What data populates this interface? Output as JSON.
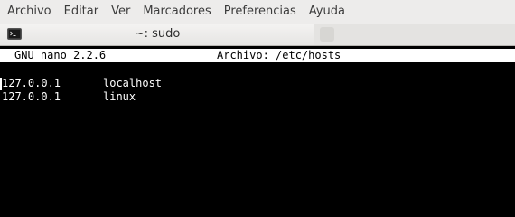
{
  "menubar": {
    "items": [
      {
        "label": "Archivo"
      },
      {
        "label": "Editar"
      },
      {
        "label": "Ver"
      },
      {
        "label": "Marcadores"
      },
      {
        "label": "Preferencias"
      },
      {
        "label": "Ayuda"
      }
    ]
  },
  "tab": {
    "title": "~: sudo",
    "icon": "terminal-icon"
  },
  "nano": {
    "version": "GNU nano 2.2.6",
    "file_label": "Archivo: /etc/hosts"
  },
  "file_lines": [
    {
      "ip": "127.0.0.1",
      "hostname": "localhost"
    },
    {
      "ip": "127.0.0.1",
      "hostname": "linux"
    }
  ],
  "colors": {
    "terminal_bg": "#000000",
    "terminal_fg": "#ffffff",
    "menubar_bg": "#edeceb"
  }
}
